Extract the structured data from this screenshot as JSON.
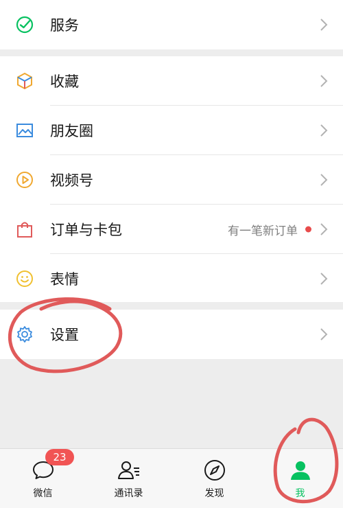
{
  "menu": {
    "services": {
      "label": "服务",
      "icon": "service-check-icon"
    },
    "favorites": {
      "label": "收藏",
      "icon": "cube-icon"
    },
    "moments": {
      "label": "朋友圈",
      "icon": "photo-icon"
    },
    "channels": {
      "label": "视频号",
      "icon": "play-circle-icon"
    },
    "orders": {
      "label": "订单与卡包",
      "icon": "shopping-bag-icon",
      "extra": "有一笔新订单"
    },
    "stickers": {
      "label": "表情",
      "icon": "smile-icon"
    },
    "settings": {
      "label": "设置",
      "icon": "gear-icon"
    }
  },
  "tabbar": {
    "tabs": [
      {
        "label": "微信",
        "icon": "chat-bubble-icon",
        "badge": "23"
      },
      {
        "label": "通讯录",
        "icon": "contacts-icon"
      },
      {
        "label": "发现",
        "icon": "compass-icon"
      },
      {
        "label": "我",
        "icon": "person-icon",
        "active": true
      }
    ]
  },
  "colors": {
    "accent": "#07c160",
    "badge": "#f15454",
    "annotation": "#e05a5a"
  }
}
